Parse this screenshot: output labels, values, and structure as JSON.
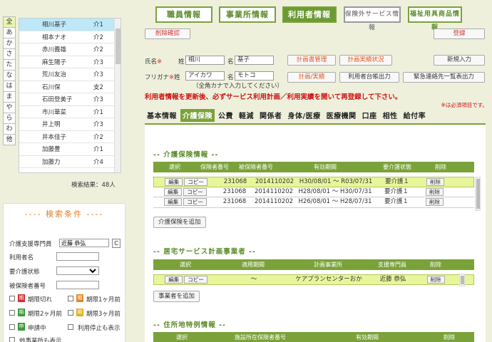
{
  "kana_index": [
    "全",
    "あ",
    "か",
    "さ",
    "た",
    "な",
    "は",
    "ま",
    "や",
    "ら",
    "わ",
    "他"
  ],
  "user_list": [
    {
      "name": "相川基子",
      "level": "介1"
    },
    {
      "name": "相本ナオ",
      "level": "介2"
    },
    {
      "name": "赤川義雄",
      "level": "介2"
    },
    {
      "name": "麻生陽子",
      "level": "介3"
    },
    {
      "name": "荒川友治",
      "level": "介3"
    },
    {
      "name": "石川保",
      "level": "支2"
    },
    {
      "name": "石田登美子",
      "level": "介3"
    },
    {
      "name": "市川華菜",
      "level": "介1"
    },
    {
      "name": "井上明",
      "level": "介3"
    },
    {
      "name": "井本佳子",
      "level": "介2"
    },
    {
      "name": "加藤豊",
      "level": "介1"
    },
    {
      "name": "加藤力",
      "level": "介4"
    }
  ],
  "results_label": "検索結果：48人",
  "conditions": {
    "title": "---- 検索条件 ----",
    "care_manager_label": "介護支援専門員",
    "care_manager_value": "近藤 恭弘",
    "c_button": "C",
    "user_name_label": "利用者名",
    "care_level_label": "要介護状態",
    "insured_no_label": "被保険者番号",
    "expired_label": "期限切れ",
    "month1_label": "期限1ヶ月前",
    "month2_label": "期限2ヶ月前",
    "month3_label": "期限3ヶ月前",
    "applying_label": "申請中",
    "stopped_label": "利用停止も表示",
    "other_office_label": "他事業所も表示",
    "tag_ki": "期",
    "tag_shin": "申"
  },
  "nav": {
    "staff": "職員情報",
    "office": "事業所情報",
    "user": "利用者情報",
    "noninsured": "保険外サービス情報",
    "welfare": "福祉用具商品情報"
  },
  "buttons": {
    "delete_confirm": "削除確認",
    "register": "登録",
    "plan_mgmt": "計画書管理",
    "plan_status": "計画実績状況",
    "new_entry": "新規入力",
    "plan_actual": "計画/実績",
    "ledger": "利用者台帳出力",
    "emergency": "緊急連絡先一覧表出力"
  },
  "name_form": {
    "name_label": "氏名",
    "req_mark": "※",
    "last_label": "姓",
    "first_label": "名",
    "last_value": "相川",
    "first_value": "基子",
    "kana_label": "フリガナ",
    "kana_last": "アイカワ",
    "kana_first": "モトコ",
    "kana_note": "（全角カナで入力してください）"
  },
  "warning": "利用者情報を更新後、必ずサービス利用計画／利用実績を開いて再登録して下さい。",
  "required_note": "※は必須項目です。",
  "tabs": [
    "基本情報",
    "介護保険",
    "公費",
    "軽減",
    "関係者",
    "身体/医療",
    "医療機関",
    "口座",
    "相性",
    "給付率"
  ],
  "care_insurance": {
    "title": "-- 介護保険情報 --",
    "headers": [
      "選択",
      "保険者番号",
      "被保険者番号",
      "有効期間",
      "要介護状態",
      "削除"
    ],
    "edit": "編集",
    "copy": "コピー",
    "delete": "削除",
    "rows": [
      {
        "insurer": "231068",
        "insured": "2014110202",
        "period": "H30/08/01 ～ R03/07/31",
        "level": "要介護１"
      },
      {
        "insurer": "231068",
        "insured": "2014110202",
        "period": "H28/08/01 ～ H30/07/31",
        "level": "要介護１"
      },
      {
        "insurer": "231068",
        "insured": "2014110202",
        "period": "H26/08/01 ～ H28/07/31",
        "level": "要介護１"
      }
    ],
    "add_label": "介護保険を追加"
  },
  "care_plan_office": {
    "title": "-- 居宅サービス計画事業者 --",
    "headers": [
      "選択",
      "適用期間",
      "計画事業所",
      "支援専門員",
      "削除"
    ],
    "rows": [
      {
        "period": "～",
        "office": "ケアプランセンターおか",
        "manager": "近藤 恭弘"
      }
    ],
    "add_label": "事業者を追加"
  },
  "address_special": {
    "title": "-- 住所地特例情報 --",
    "headers": [
      "選択",
      "施設所在保険者番号",
      "有効期間",
      "削除"
    ]
  },
  "colors": {
    "accent": "#7ba23a",
    "warning": "#d01010",
    "selected_row": "#bde8f8",
    "highlight_row": "#e8f59a"
  }
}
